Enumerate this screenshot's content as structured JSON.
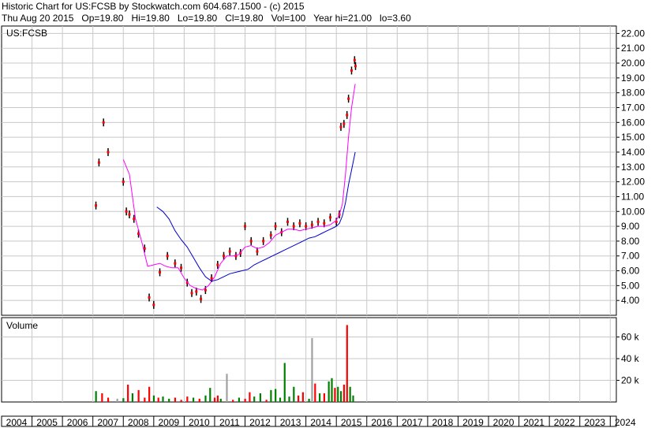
{
  "header": {
    "line1": "Historic Chart for US:FCSB by Stockwatch.com 604.687.1500 - (c) 2015",
    "line2": "Thu Aug 20 2015   Op=19.80   Hi=19.80   Lo=19.80   Cl=19.80   Vol=100   Year hi=21.00   lo=3.60"
  },
  "colors": {
    "price_bar": "#000000",
    "price_close": "#ff0000",
    "ma_short": "#ff00ff",
    "ma_long": "#0000cc",
    "vol_up": "#008000",
    "vol_down": "#ff0000",
    "vol_flat": "#a0a0a0",
    "grid": "#c8c8c8"
  },
  "chart_data": [
    {
      "type": "line",
      "title": "US:FCSB",
      "ylim": [
        3.0,
        22.5
      ],
      "y_ticks": [
        "4.00",
        "5.00",
        "6.00",
        "7.00",
        "8.00",
        "9.00",
        "10.00",
        "11.00",
        "12.00",
        "13.00",
        "14.00",
        "15.00",
        "16.00",
        "17.00",
        "18.00",
        "19.00",
        "20.00",
        "21.00",
        "22.00"
      ],
      "xlim": [
        2004.0,
        2024.2
      ],
      "series": [
        {
          "x": [
            2007.1,
            2007.2,
            2007.35,
            2007.5,
            2008.0,
            2008.1,
            2008.2,
            2008.35,
            2008.5,
            2008.7,
            2008.85,
            2009.0,
            2009.2,
            2009.45,
            2009.7,
            2009.9,
            2010.1,
            2010.25,
            2010.4,
            2010.55,
            2010.7,
            2010.9,
            2011.1,
            2011.3,
            2011.5,
            2011.7,
            2011.85,
            2012.0,
            2012.2,
            2012.4,
            2012.6,
            2012.85,
            2013.0,
            2013.2,
            2013.4,
            2013.6,
            2013.8,
            2014.0,
            2014.2,
            2014.4,
            2014.6,
            2014.8,
            2015.0,
            2015.1,
            2015.15,
            2015.25,
            2015.35,
            2015.4,
            2015.5,
            2015.6,
            2015.63
          ],
          "close": [
            10.4,
            13.3,
            16.0,
            14.0,
            12.0,
            10.0,
            9.8,
            9.5,
            8.5,
            7.5,
            4.2,
            3.7,
            5.9,
            7.0,
            6.5,
            6.2,
            5.2,
            4.5,
            4.6,
            4.1,
            4.7,
            5.5,
            6.4,
            7.0,
            7.3,
            7.0,
            7.2,
            9.0,
            8.0,
            7.3,
            8.0,
            8.4,
            9.0,
            8.6,
            9.3,
            9.0,
            9.2,
            9.0,
            9.1,
            9.3,
            9.2,
            9.6,
            9.3,
            9.8,
            15.7,
            15.9,
            16.5,
            17.6,
            19.5,
            20.2,
            19.8
          ]
        },
        {
          "x": [
            2008.0,
            2008.2,
            2008.4,
            2008.6,
            2008.8,
            2009.0,
            2009.2,
            2009.4,
            2009.6,
            2009.8,
            2010.0,
            2010.2,
            2010.4,
            2010.6,
            2010.8,
            2011.0,
            2011.2,
            2011.4,
            2011.6,
            2011.8,
            2012.0,
            2012.2,
            2012.4,
            2012.6,
            2012.8,
            2013.0,
            2013.2,
            2013.4,
            2013.6,
            2013.8,
            2014.0,
            2014.2,
            2014.4,
            2014.6,
            2014.8,
            2015.0,
            2015.1,
            2015.2,
            2015.3,
            2015.4,
            2015.5,
            2015.62
          ],
          "ma_short": [
            13.5,
            12.5,
            9.5,
            8.0,
            6.3,
            6.4,
            6.5,
            6.3,
            6.2,
            6.2,
            5.5,
            5.0,
            4.8,
            4.7,
            5.0,
            5.6,
            6.5,
            7.0,
            7.0,
            7.1,
            7.6,
            7.7,
            7.5,
            7.6,
            7.9,
            8.4,
            8.6,
            8.8,
            8.8,
            8.7,
            8.8,
            8.9,
            9.0,
            9.0,
            9.1,
            9.4,
            9.8,
            10.5,
            12.5,
            15.0,
            17.0,
            18.6
          ]
        },
        {
          "x": [
            2009.1,
            2009.3,
            2009.5,
            2009.7,
            2009.9,
            2010.1,
            2010.3,
            2010.5,
            2010.7,
            2010.9,
            2011.1,
            2011.3,
            2011.5,
            2011.7,
            2011.9,
            2012.1,
            2012.3,
            2012.5,
            2012.7,
            2012.9,
            2013.1,
            2013.3,
            2013.5,
            2013.7,
            2013.9,
            2014.1,
            2014.3,
            2014.5,
            2014.7,
            2014.9,
            2015.0,
            2015.1,
            2015.2,
            2015.3,
            2015.4,
            2015.5,
            2015.62
          ],
          "ma_long": [
            10.3,
            10.0,
            9.5,
            8.7,
            8.1,
            7.6,
            6.9,
            6.2,
            5.6,
            5.3,
            5.4,
            5.6,
            5.8,
            5.9,
            6.0,
            6.1,
            6.4,
            6.6,
            6.8,
            7.0,
            7.2,
            7.4,
            7.6,
            7.8,
            8.0,
            8.2,
            8.3,
            8.5,
            8.7,
            8.9,
            9.0,
            9.2,
            9.7,
            10.6,
            11.8,
            12.8,
            14.0
          ]
        }
      ]
    },
    {
      "type": "bar",
      "title": "Volume",
      "ylim": [
        0,
        72000
      ],
      "y_ticks": [
        "20 k",
        "40 k",
        "60 k"
      ],
      "x": [
        2007.1,
        2007.3,
        2007.5,
        2007.8,
        2008.0,
        2008.15,
        2008.3,
        2008.5,
        2008.7,
        2008.85,
        2009.0,
        2009.15,
        2009.3,
        2009.5,
        2009.7,
        2009.9,
        2010.1,
        2010.3,
        2010.5,
        2010.7,
        2010.85,
        2011.0,
        2011.1,
        2011.2,
        2011.4,
        2011.6,
        2011.8,
        2012.0,
        2012.15,
        2012.3,
        2012.5,
        2012.7,
        2012.85,
        2013.0,
        2013.15,
        2013.3,
        2013.45,
        2013.6,
        2013.75,
        2013.9,
        2014.1,
        2014.2,
        2014.3,
        2014.45,
        2014.6,
        2014.75,
        2014.85,
        2014.95,
        2015.05,
        2015.15,
        2015.25,
        2015.35,
        2015.45,
        2015.55
      ],
      "values": [
        10000,
        8000,
        4000,
        3000,
        3500,
        16000,
        8000,
        11000,
        4000,
        14000,
        6000,
        4000,
        5000,
        3000,
        4000,
        2000,
        5000,
        4000,
        3000,
        6000,
        13000,
        4000,
        6000,
        3000,
        26000,
        2000,
        4000,
        3000,
        9000,
        5000,
        8000,
        2000,
        11000,
        12000,
        4000,
        36000,
        5000,
        14000,
        6000,
        9000,
        3000,
        59000,
        17000,
        8000,
        8000,
        19000,
        22000,
        13000,
        14000,
        10000,
        16000,
        71000,
        14000,
        6000
      ],
      "colors": [
        "up",
        "down",
        "down",
        "flat",
        "up",
        "down",
        "up",
        "down",
        "down",
        "down",
        "up",
        "down",
        "up",
        "up",
        "down",
        "down",
        "down",
        "up",
        "down",
        "up",
        "up",
        "down",
        "down",
        "up",
        "flat",
        "down",
        "up",
        "down",
        "down",
        "up",
        "up",
        "down",
        "up",
        "up",
        "up",
        "up",
        "up",
        "up",
        "down",
        "down",
        "up",
        "flat",
        "down",
        "up",
        "down",
        "up",
        "up",
        "down",
        "up",
        "up",
        "down",
        "down",
        "up",
        "up"
      ]
    }
  ],
  "x_axis": {
    "labels": [
      "2004",
      "2005",
      "2006",
      "2007",
      "2008",
      "2009",
      "2010",
      "2011",
      "2012",
      "2013",
      "2014",
      "2015",
      "2016",
      "2017",
      "2018",
      "2019",
      "2020",
      "2021",
      "2022",
      "2023",
      "2024"
    ]
  }
}
